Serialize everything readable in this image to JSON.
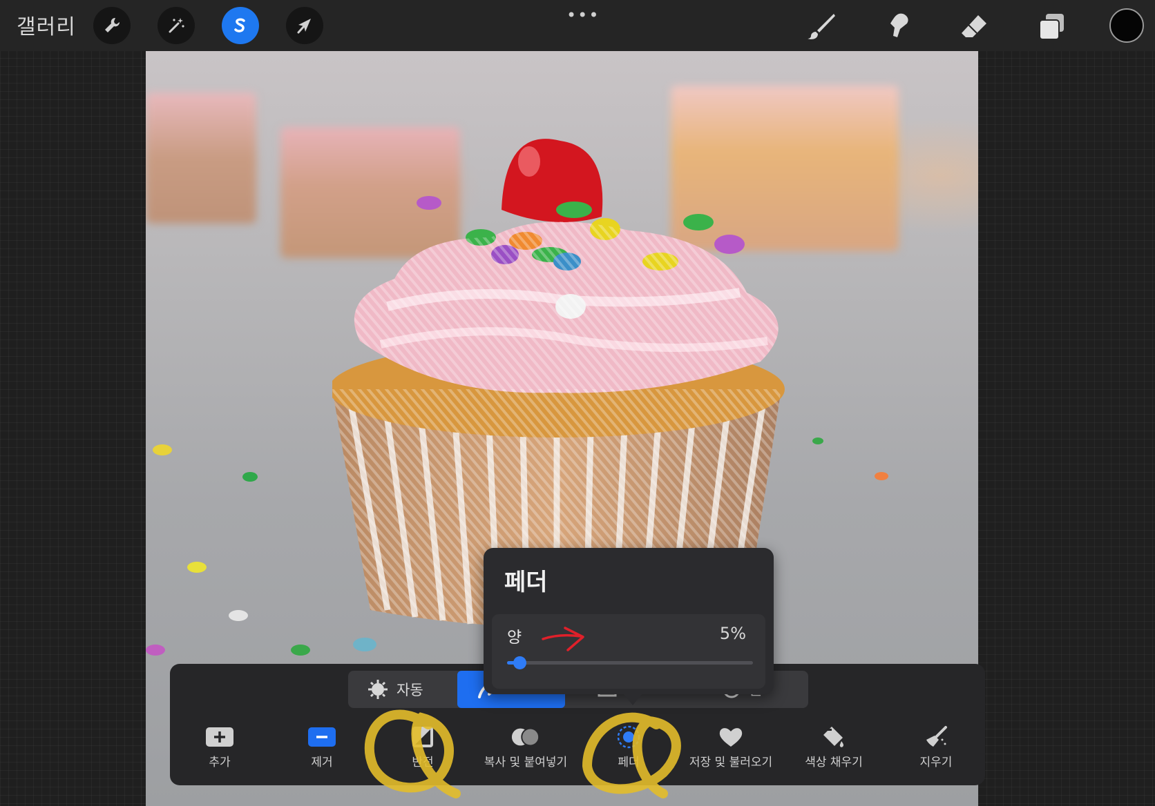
{
  "topbar": {
    "gallery_label": "갤러리",
    "more_label": "•••",
    "tools": [
      {
        "name": "wrench-icon"
      },
      {
        "name": "magic-wand-icon"
      },
      {
        "name": "selection-icon",
        "active": true
      },
      {
        "name": "transform-arrow-icon"
      }
    ],
    "right_tools": [
      {
        "name": "brush-icon"
      },
      {
        "name": "smudge-icon"
      },
      {
        "name": "eraser-icon"
      },
      {
        "name": "layers-icon"
      }
    ],
    "current_color": "#050505"
  },
  "selection_panel": {
    "modes": [
      {
        "label": "자동",
        "icon": "auto-sun-icon"
      },
      {
        "label": "",
        "icon": "freehand-icon",
        "active": true
      },
      {
        "label": "",
        "icon": "rectangle-icon"
      },
      {
        "label": "원",
        "icon": "ellipse-icon"
      }
    ],
    "actions": [
      {
        "label": "추가",
        "icon": "plus-icon"
      },
      {
        "label": "제거",
        "icon": "minus-icon",
        "highlight": "#1e6ef0"
      },
      {
        "label": "반전",
        "icon": "invert-icon"
      },
      {
        "label": "복사 및 붙여넣기",
        "icon": "copy-paste-icon"
      },
      {
        "label": "페더",
        "icon": "feather-icon",
        "highlight": "#2f7cf6"
      },
      {
        "label": "저장 및 불러오기",
        "icon": "heart-icon"
      },
      {
        "label": "색상 채우기",
        "icon": "color-fill-icon"
      },
      {
        "label": "지우기",
        "icon": "clear-brush-icon"
      }
    ]
  },
  "feather_popover": {
    "title": "페더",
    "amount_label": "양",
    "amount_value": "5%",
    "amount_fraction": 0.05
  },
  "colors": {
    "accent": "#1e78f0",
    "annotation_yellow": "#e3bd2a",
    "annotation_red": "#e0202a"
  }
}
